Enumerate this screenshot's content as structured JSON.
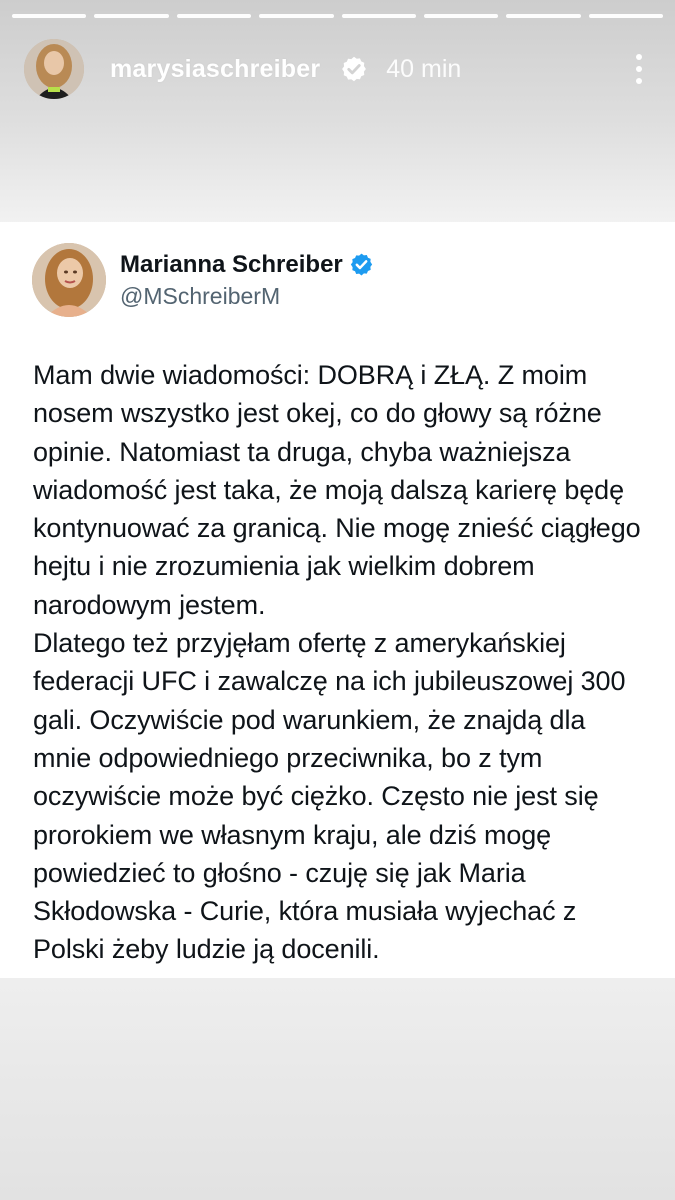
{
  "story": {
    "progress_segments": 8,
    "username": "marysiaschreiber",
    "time_ago": "40 min",
    "icons": {
      "verified": "verified-badge-icon",
      "more": "more-vertical-icon"
    }
  },
  "tweet": {
    "display_name": "Marianna Schreiber",
    "handle": "@MSchreiberM",
    "accent_color": "#1d9bf0",
    "text": "Mam dwie wiadomości: DOBRĄ i ZŁĄ. Z moim nosem wszystko jest okej, co do głowy są różne opinie. Natomiast ta druga, chyba ważniejsza wiadomość jest taka, że moją dalszą karierę będę kontynuować za granicą. Nie mogę znieść ciągłego hejtu i nie zrozumienia jak wielkim dobrem narodowym jestem.\nDlatego też przyjęłam ofertę z amerykańskiej federacji UFC i zawalczę na ich jubileuszowej 300 gali. Oczywiście pod warunkiem, że znajdą dla mnie odpowiedniego przeciwnika, bo z tym oczywiście może być ciężko. Często nie jest się prorokiem we własnym kraju, ale dziś mogę powiedzieć to głośno - czuję się jak Maria Skłodowska - Curie, która musiała wyjechać z Polski żeby ludzie ją docenili."
  }
}
